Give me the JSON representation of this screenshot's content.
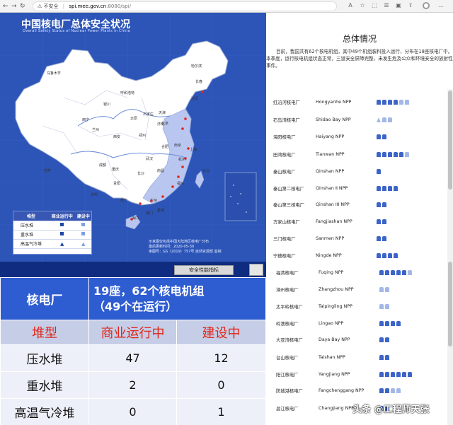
{
  "browser": {
    "security_label": "不安全",
    "url_host": "spi.mee.gov.cn",
    "url_path": ":8080/spi/"
  },
  "map": {
    "title": "中国核电厂总体安全状况",
    "subtitle": "Overall Safety Status of Nuclear Power Plants in China",
    "legend": {
      "headers": [
        "堆型",
        "商业运行中",
        "建设中"
      ],
      "rows": [
        "压水堆",
        "重水堆",
        "高温气冷堆"
      ]
    },
    "notes": [
      "示意图仅包括中国大陆地区核电厂分布",
      "最后更新时间：2020-05-30",
      "审图号：GS（2019）757号 自然资源部 监制"
    ],
    "cities": [
      "北京",
      "上海",
      "成都",
      "武汉",
      "海口",
      "乌鲁木齐",
      "拉萨",
      "西宁",
      "兰州",
      "西安",
      "郑州",
      "太原",
      "石家庄",
      "济南",
      "南京",
      "合肥",
      "杭州",
      "长沙",
      "南昌",
      "福州",
      "广州",
      "南宁",
      "贵阳",
      "昆明",
      "重庆",
      "哈尔滨",
      "长春",
      "沈阳",
      "呼和浩特",
      "银川",
      "天津",
      "台北",
      "香港",
      "澳门"
    ],
    "perf_button": "安全性能指标"
  },
  "overview": {
    "title": "总体情况",
    "text": "目前，我国共有62个核电机组，其中49个机组装料投入运行，分布在18座核电厂中。本季度，运行核电机组状态正常，三道安全屏障完整，未发生危及公众和环境安全的放射性事件。"
  },
  "plants": [
    {
      "zh": "红沿河核电厂",
      "en": "Hongyanhe NPP",
      "units": [
        "o",
        "o",
        "o",
        "o",
        "c",
        "c"
      ]
    },
    {
      "zh": "石岛湾核电厂",
      "en": "Shidao Bay NPP",
      "units": [
        "t",
        "c",
        "c"
      ]
    },
    {
      "zh": "海阳核电厂",
      "en": "Haiyang NPP",
      "units": [
        "o",
        "o"
      ]
    },
    {
      "zh": "田湾核电厂",
      "en": "Tianwan NPP",
      "units": [
        "o",
        "o",
        "o",
        "o",
        "o",
        "c"
      ]
    },
    {
      "zh": "秦山核电厂",
      "en": "Qinshan NPP",
      "units": [
        "o"
      ]
    },
    {
      "zh": "秦山第二核电厂",
      "en": "Qinshan Ⅱ NPP",
      "units": [
        "o",
        "o",
        "o",
        "o"
      ]
    },
    {
      "zh": "秦山第三核电厂",
      "en": "Qinshan III NPP",
      "units": [
        "o",
        "o"
      ]
    },
    {
      "zh": "方家山核电厂",
      "en": "Fangjiashan NPP",
      "units": [
        "o",
        "o"
      ]
    },
    {
      "zh": "三门核电厂",
      "en": "Sanmen NPP",
      "units": [
        "o",
        "o"
      ]
    },
    {
      "zh": "宁德核电厂",
      "en": "Ningde NPP",
      "units": [
        "o",
        "o",
        "o",
        "o"
      ]
    },
    {
      "zh": "福清核电厂",
      "en": "Fuqing NPP",
      "units": [
        "o",
        "o",
        "o",
        "o",
        "o",
        "c"
      ]
    },
    {
      "zh": "漳州核电厂",
      "en": "Zhangzhou NPP",
      "units": [
        "c",
        "c"
      ]
    },
    {
      "zh": "太平岭核电厂",
      "en": "Taipingling NPP",
      "units": [
        "c",
        "c"
      ]
    },
    {
      "zh": "岭澳核电厂",
      "en": "Lingao NPP",
      "units": [
        "o",
        "o",
        "o",
        "o"
      ]
    },
    {
      "zh": "大亚湾核电厂",
      "en": "Daya Bay NPP",
      "units": [
        "o",
        "o"
      ]
    },
    {
      "zh": "台山核电厂",
      "en": "Taishan NPP",
      "units": [
        "o",
        "o"
      ]
    },
    {
      "zh": "阳江核电厂",
      "en": "Yangjiang NPP",
      "units": [
        "o",
        "o",
        "o",
        "o",
        "o",
        "o"
      ]
    },
    {
      "zh": "防城港核电厂",
      "en": "Fangchenggang NPP",
      "units": [
        "o",
        "o",
        "c",
        "c"
      ]
    },
    {
      "zh": "昌江核电厂",
      "en": "Changjiang NPP",
      "units": [
        "o",
        "o"
      ]
    }
  ],
  "summary": {
    "head_label": "核电厂",
    "head_line1": "19座，62个核电机组",
    "head_line2": "（49个在运行）",
    "columns": [
      "堆型",
      "商业运行中",
      "建设中"
    ],
    "rows": [
      {
        "type": "压水堆",
        "operating": "47",
        "construction": "12"
      },
      {
        "type": "重水堆",
        "operating": "2",
        "construction": "0"
      },
      {
        "type": "高温气冷堆",
        "operating": "0",
        "construction": "1"
      }
    ]
  },
  "watermark": "头条 @工程师天张",
  "colors": {
    "map_bg": "#2d55b8",
    "land": "#ffffff",
    "east_region": "#b8c6f0",
    "header_blue": "#2e5cd1",
    "red_text": "#e0261a"
  }
}
